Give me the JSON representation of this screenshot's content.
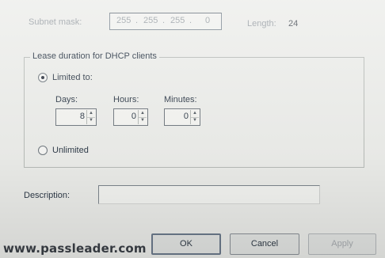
{
  "subnet": {
    "label": "Subnet mask:",
    "octets": [
      "255",
      "255",
      "255",
      "0"
    ],
    "dot": ".",
    "length_label": "Length:",
    "length_value": "24"
  },
  "lease": {
    "group_title": "Lease duration for DHCP clients",
    "limited_label": "Limited to:",
    "limited_selected": true,
    "days_label": "Days:",
    "days_value": "8",
    "hours_label": "Hours:",
    "hours_value": "0",
    "minutes_label": "Minutes:",
    "minutes_value": "0",
    "unlimited_label": "Unlimited"
  },
  "description": {
    "label": "Description:",
    "value": ""
  },
  "buttons": {
    "ok": "OK",
    "cancel": "Cancel",
    "apply": "Apply"
  },
  "watermark": "www.passleader.com"
}
